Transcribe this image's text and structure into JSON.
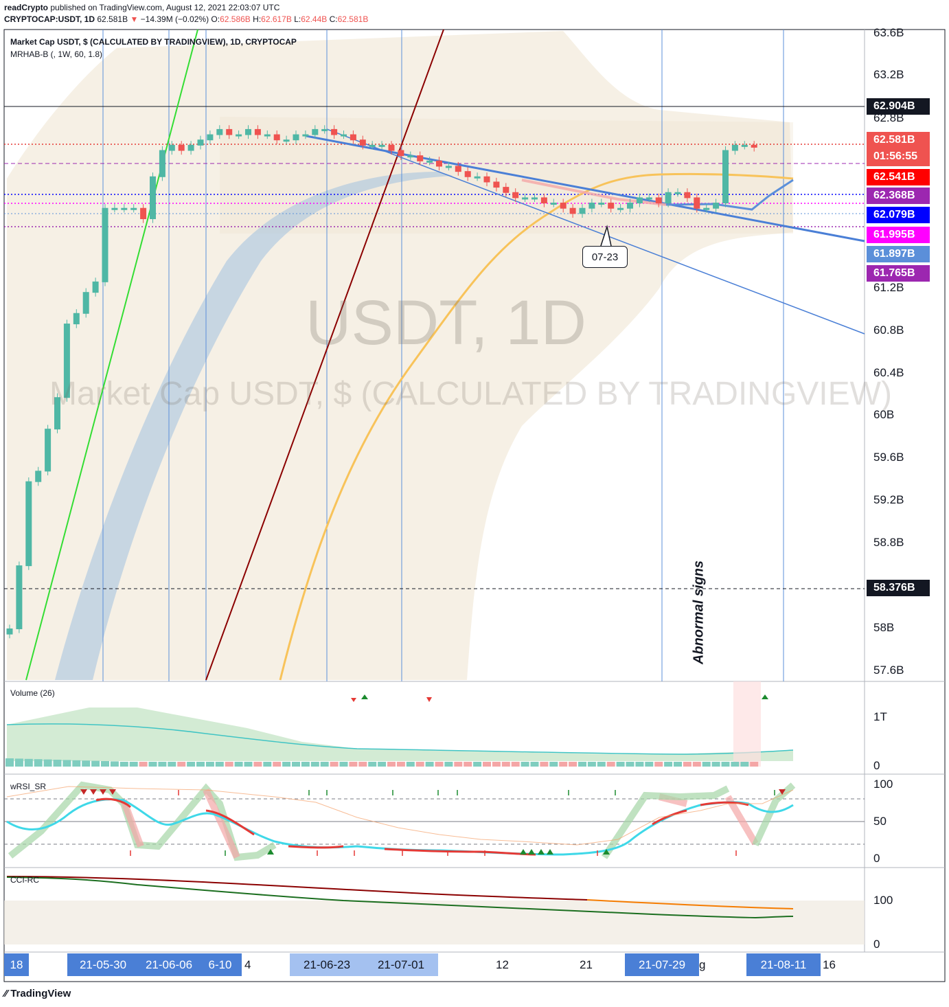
{
  "header": {
    "publisher": "readCrypto",
    "published_text": "published on TradingView.com, August 12, 2021 22:03:07 UTC",
    "symbol": "CRYPTOCAP:USDT, 1D",
    "last": "62.581B",
    "change_arrow": "▼",
    "change": "−14.39M (−0.02%)",
    "o_label": "O:",
    "o_value": "62.586B",
    "h_label": "H:",
    "h_value": "62.617B",
    "l_label": "L:",
    "l_value": "62.44B",
    "c_label": "C:",
    "c_value": "62.581B"
  },
  "legend": {
    "series_title": "Market Cap USDT, $ (CALCULATED BY TRADINGVIEW), 1D, CRYPTOCAP",
    "indicator": "MRHAB-B (, 1W, 60, 1.8)"
  },
  "watermark": {
    "symbol": "USDT, 1D",
    "description": "Market Cap USDT, $ (CALCULATED BY TRADINGVIEW)"
  },
  "annotations": {
    "callout": "07-23",
    "vertical_text": "Abnormal signs"
  },
  "price_axis": [
    "63.6B",
    "63.2B",
    "62.8B",
    "61.2B",
    "60.8B",
    "60.4B",
    "60B",
    "59.6B",
    "59.2B",
    "58.8B",
    "58B",
    "57.6B"
  ],
  "price_tags": [
    {
      "label": "62.904B",
      "color": "#131722"
    },
    {
      "label": "62.581B",
      "sub": "01:56:55",
      "color": "#ef5350"
    },
    {
      "label": "62.541B",
      "color": "#ff0000"
    },
    {
      "label": "62.368B",
      "color": "#9c27b0"
    },
    {
      "label": "62.079B",
      "color": "#0000ff"
    },
    {
      "label": "61.995B",
      "color": "#ff00ff"
    },
    {
      "label": "61.897B",
      "color": "#5b8fd9"
    },
    {
      "label": "61.765B",
      "color": "#9c27b0"
    },
    {
      "label": "58.376B",
      "color": "#131722"
    }
  ],
  "volume_pane": {
    "title": "Volume (26)",
    "axis": [
      "1T",
      "0"
    ]
  },
  "rsi_pane": {
    "title": "wRSI_SR",
    "axis": [
      "100",
      "50",
      "0"
    ]
  },
  "cci_pane": {
    "title": "CCI-RC",
    "axis": [
      "100",
      "0"
    ]
  },
  "time_axis": {
    "highlighted": [
      "18",
      "21-05-30",
      "21-06-06",
      "6-10",
      "21-06-23",
      "21-07-01",
      "21-07-29",
      "21-08-11"
    ],
    "plain": [
      "4",
      "12",
      "21",
      "g",
      "16"
    ]
  },
  "footer": {
    "brand": "TradingView"
  },
  "chart_data": {
    "type": "candlestick",
    "title": "Market Cap USDT, $ (CALCULATED BY TRADINGVIEW), 1D, CRYPTOCAP",
    "ylim": [
      57.5,
      63.7
    ],
    "y_unit": "B",
    "approx_close_series": [
      58.0,
      58.6,
      59.4,
      59.5,
      59.9,
      60.2,
      60.9,
      61.0,
      61.2,
      61.3,
      62.0,
      62.0,
      62.0,
      62.0,
      61.9,
      62.3,
      62.55,
      62.6,
      62.55,
      62.6,
      62.65,
      62.7,
      62.75,
      62.7,
      62.7,
      62.75,
      62.7,
      62.7,
      62.65,
      62.65,
      62.7,
      62.7,
      62.75,
      62.75,
      62.7,
      62.7,
      62.65,
      62.6,
      62.6,
      62.6,
      62.55,
      62.5,
      62.5,
      62.45,
      62.45,
      62.4,
      62.4,
      62.35,
      62.3,
      62.3,
      62.25,
      62.2,
      62.15,
      62.1,
      62.1,
      62.1,
      62.05,
      62.05,
      62.0,
      61.95,
      62.0,
      62.05,
      62.05,
      62.0,
      62.0,
      62.05,
      62.1,
      62.1,
      62.05,
      62.15,
      62.15,
      62.1,
      62.0,
      62.0,
      62.05,
      62.55,
      62.6,
      62.6,
      62.58
    ],
    "horizontal_levels": [
      62.904,
      62.581,
      62.541,
      62.368,
      62.079,
      61.995,
      61.897,
      61.765,
      58.376
    ],
    "volume_axis": [
      "0",
      "1T"
    ],
    "rsi_levels": [
      80,
      50,
      20
    ],
    "cci_levels": [
      100,
      0
    ]
  }
}
